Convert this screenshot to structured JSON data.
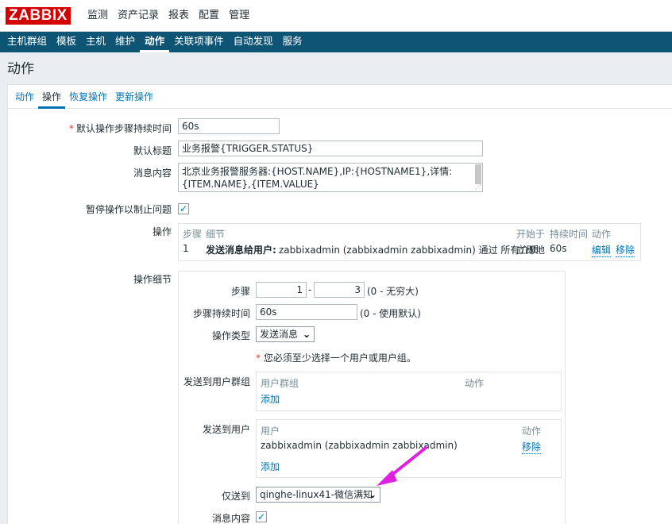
{
  "header": {
    "logo": "ZABBIX",
    "main_nav": [
      "监测",
      "资产记录",
      "报表",
      "配置",
      "管理"
    ],
    "sub_nav": [
      "主机群组",
      "模板",
      "主机",
      "维护",
      "动作",
      "关联项事件",
      "自动发现",
      "服务"
    ]
  },
  "page_title": "动作",
  "tabs": [
    "动作",
    "操作",
    "恢复操作",
    "更新操作"
  ],
  "form": {
    "step_duration": {
      "label": "默认操作步骤持续时间",
      "required_mark": "*",
      "value": "60s"
    },
    "subject": {
      "label": "默认标题",
      "value": "业务报警{TRIGGER.STATUS}"
    },
    "message": {
      "label": "消息内容",
      "line1": "北京业务报警服务器:{HOST.NAME},IP:{HOSTNAME1},详情:",
      "line2": "{ITEM.NAME},{ITEM.VALUE}"
    },
    "pause": {
      "label": "暂停操作以制止问题",
      "checked": true,
      "check_glyph": "✓"
    },
    "operations": {
      "label": "操作",
      "headers": {
        "steps": "步骤",
        "details": "细节",
        "start_in": "开始于",
        "duration": "持续时间",
        "action": "动作"
      },
      "row": {
        "step": "1",
        "detail_bold": "发送消息给用户:",
        "detail_rest": "zabbixadmin (zabbixadmin zabbixadmin) 通过 所有介质",
        "start_in": "立即地",
        "duration": "60s",
        "edit": "编辑",
        "remove": "移除"
      }
    },
    "op_details": {
      "label": "操作细节",
      "steps": {
        "label": "步骤",
        "from": "1",
        "sep": "-",
        "to": "3",
        "hint": "(0 - 无穷大)"
      },
      "step_duration": {
        "label": "步骤持续时间",
        "value": "60s",
        "hint": "(0 - 使用默认)"
      },
      "op_type": {
        "label": "操作类型",
        "value": "发送消息"
      },
      "warning": {
        "mark": "*",
        "text": "您必须至少选择一个用户或用户组。"
      },
      "user_groups": {
        "label": "发送到用户群组",
        "col1": "用户群组",
        "col2": "动作",
        "add": "添加"
      },
      "users": {
        "label": "发送到用户",
        "col1": "用户",
        "col2": "动作",
        "user": "zabbixadmin (zabbixadmin zabbixadmin)",
        "remove": "移除",
        "add": "添加"
      },
      "send_only_to": {
        "label": "仅送到",
        "value": "qinghe-linux41-微信满知"
      },
      "message_content": {
        "label": "消息内容",
        "checked": true,
        "check_glyph": "✓"
      }
    }
  },
  "icons": {
    "chevron": "chevron-down-icon",
    "arrow": "annotation-arrow"
  },
  "colors": {
    "brand": "#d40000",
    "subnav": "#0e5475",
    "link": "#0275b8",
    "arrow": "#e020e0"
  }
}
